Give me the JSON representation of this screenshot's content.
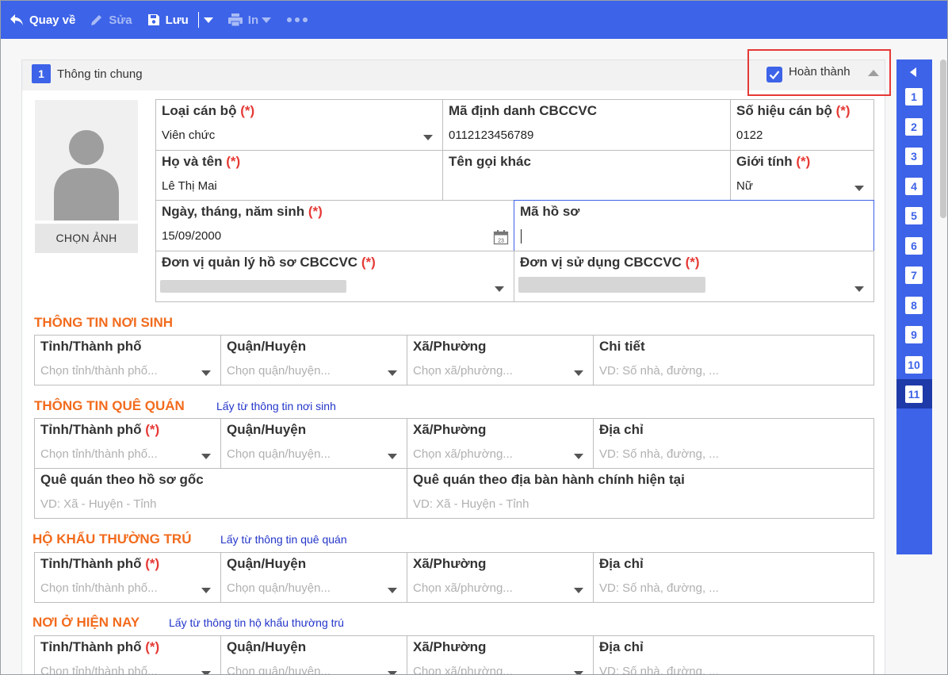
{
  "toolbar": {
    "back": "Quay về",
    "edit": "Sửa",
    "save": "Lưu",
    "print": "In"
  },
  "section": {
    "number": "1",
    "title": "Thông tin chung",
    "complete_label": "Hoàn thành",
    "complete_checked": true
  },
  "photo": {
    "choose_label": "CHỌN ẢNH"
  },
  "fields": {
    "loai_can_bo": {
      "label": "Loại cán bộ",
      "req": "(*)",
      "value": "Viên chức"
    },
    "ma_dinh_danh": {
      "label": "Mã định danh CBCCVC",
      "value": "0112123456789"
    },
    "so_hieu": {
      "label": "Số hiệu cán bộ",
      "req": "(*)",
      "value": "0122"
    },
    "ho_ten": {
      "label": "Họ và tên",
      "req": "(*)",
      "value": "Lê Thị Mai"
    },
    "ten_goi_khac": {
      "label": "Tên gọi khác",
      "value": ""
    },
    "gioi_tinh": {
      "label": "Giới tính",
      "req": "(*)",
      "value": "Nữ"
    },
    "ngay_sinh": {
      "label": "Ngày, tháng, năm sinh",
      "req": "(*)",
      "value": "15/09/2000",
      "cal_day": "23"
    },
    "ma_ho_so": {
      "label": "Mã hồ sơ",
      "value": ""
    },
    "don_vi_quan_ly": {
      "label": "Đơn vị quản lý hồ sơ CBCCVC",
      "req": "(*)"
    },
    "don_vi_su_dung": {
      "label": "Đơn vị sử dụng CBCCVC",
      "req": "(*)"
    }
  },
  "common": {
    "tinh": "Tỉnh/Thành phố",
    "huyen": "Quận/Huyện",
    "xa": "Xã/Phường",
    "chi_tiet": "Chi tiết",
    "dia_chi": "Địa chỉ",
    "req": "(*)",
    "ph_tinh": "Chọn tỉnh/thành phố...",
    "ph_huyen": "Chọn quận/huyện...",
    "ph_xa": "Chọn xã/phường...",
    "ph_dia_chi": "VD: Số nhà, đường, ..."
  },
  "noi_sinh": {
    "title": "THÔNG TIN NƠI SINH"
  },
  "que_quan": {
    "title": "THÔNG TIN QUÊ QUÁN",
    "link": "Lấy từ thông tin nơi sinh",
    "goc_label": "Quê quán theo hồ sơ gốc",
    "hien_tai_label": "Quê quán theo địa bàn hành chính hiện tại",
    "ph_xhtt": "VD: Xã - Huyện - Tỉnh"
  },
  "ho_khau": {
    "title": "HỘ KHẨU THƯỜNG TRÚ",
    "link": "Lấy từ thông tin quê quán"
  },
  "noi_o": {
    "title": "NƠI Ở HIỆN NAY",
    "link": "Lấy từ thông tin hộ khẩu thường trú"
  },
  "nav": {
    "items": [
      "1",
      "2",
      "3",
      "4",
      "5",
      "6",
      "7",
      "8",
      "9",
      "10",
      "11"
    ]
  },
  "colors": {
    "accent": "#3d63e8",
    "section_header": "#f26b1d",
    "required": "#e53935",
    "link": "#2335c9"
  }
}
